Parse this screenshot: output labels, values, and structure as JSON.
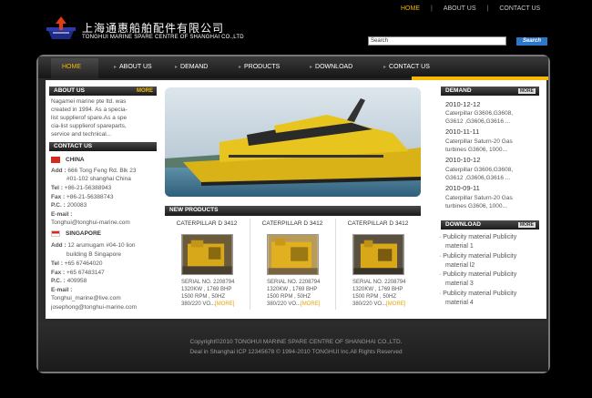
{
  "header": {
    "title_cn": "上海通惠船舶配件有限公司",
    "title_en": "TONGHUI MARINE SPARE CENTRE  OF  SHANGHAI CO.,LTD",
    "top_nav": [
      "HOME",
      "ABOUT US",
      "CONTACT US"
    ],
    "top_nav_sep": "|",
    "search_value": "Search",
    "search_button": "Search"
  },
  "nav": [
    "HOME",
    "ABOUT US",
    "DEMAND",
    "PRODUCTS",
    "DOWNLOAD",
    "CONTACT US"
  ],
  "about": {
    "heading": "ABOUT US",
    "more": "MORE",
    "lines": [
      "Nagamei marine pte ltd. was",
      "created in 1994. As a specia-",
      "list supplierof spare.As a spe",
      "cia-list supplierof spareparts,",
      "service and technical..."
    ]
  },
  "contact": {
    "heading": "CONTACT US",
    "china": {
      "country": "CHINA",
      "add_label": "Add :",
      "add1": "666 Tong Feng Rd. Blk 23",
      "add2": "#01-102  shanghai China",
      "tel_label": "Tel :",
      "tel": "+86-21-56388943",
      "fax_label": "Fax :",
      "fax": "+86-21-56388743",
      "pc_label": "P.C. :",
      "pc": "200083",
      "email_label": "E-mail :",
      "email": "Tonghui@tonghui-marine.com"
    },
    "singapore": {
      "country": "SINGAPORE",
      "add_label": "Add :",
      "add1": "12 arumugam #04-10  lion",
      "add2": "building B Singapore",
      "tel_label": "Tel :",
      "tel": "+65 67464020",
      "fax_label": "Fax :",
      "fax": "+65 67483147",
      "pc_label": "P.C. :",
      "pc": "409958",
      "email_label": "E-mail :",
      "email1": "Tonghui_marine@live.com",
      "email2": "josephong@tonghui-marine.com"
    }
  },
  "new_products": {
    "heading": "NEW PRODUCTS",
    "items": [
      {
        "title": "CATERPILLAR D 3412",
        "serial": "SERIAL NO. 2208794",
        "spec1": "1320KW , 1769 BHP",
        "spec2": "1500 RPM , 50HZ",
        "spec3": "380/220 VO...",
        "more": "[MORE]"
      },
      {
        "title": "CATERPILLAR D 3412",
        "serial": "SERIAL NO. 2208794",
        "spec1": "1320KW , 1769 BHP",
        "spec2": "1500 RPM , 50HZ",
        "spec3": "380/220 VO...",
        "more": "[MORE]"
      },
      {
        "title": "CATERPILLAR D 3412",
        "serial": "SERIAL NO. 2208794",
        "spec1": "1320KW , 1769 BHP",
        "spec2": "1500 RPM , 50HZ",
        "spec3": "380/220 VO...",
        "more": "[MORE]"
      }
    ]
  },
  "demand": {
    "heading": "DEMAND",
    "more": "MORE",
    "items": [
      {
        "date": "2010-12-12",
        "l1": "Caterpillar G3606,G3608,",
        "l2": "G3612 ,G3606,G3616 ..."
      },
      {
        "date": "2010-11-11",
        "l1": "Caterpillar Saturn-20 Gas",
        "l2": "turbines G3606, 1000..."
      },
      {
        "date": "2010-10-12",
        "l1": "Caterpillar G3606,G3608,",
        "l2": "G3612 ,G3606,G3616 ..."
      },
      {
        "date": "2010-09-11",
        "l1": "Caterpillar Saturn-20 Gas",
        "l2": "turbines G3606, 1000..."
      }
    ]
  },
  "download": {
    "heading": "DOWNLOAD",
    "more": "MORE",
    "items": [
      {
        "l1": "Publicity material Publicity",
        "l2": "material 1"
      },
      {
        "l1": "Publicity material Publicity",
        "l2": "material l2"
      },
      {
        "l1": "Publicity material Publicity",
        "l2": "material 3"
      },
      {
        "l1": "Publicity material Publicity",
        "l2": "material 4"
      }
    ]
  },
  "footer": {
    "copyright": "Copyright©2010 TONGHUI MARINE SPARE CENTRE  OF SHANGHAI CO.,LTD.",
    "icp": "Deal  in   Shanghai ICP 12345678 © 1994-2010 TONGHUI Inc.All Rights Reserved"
  },
  "colors": {
    "accent": "#f6b800",
    "search_button": "#2d77c8",
    "background": "#000000"
  }
}
